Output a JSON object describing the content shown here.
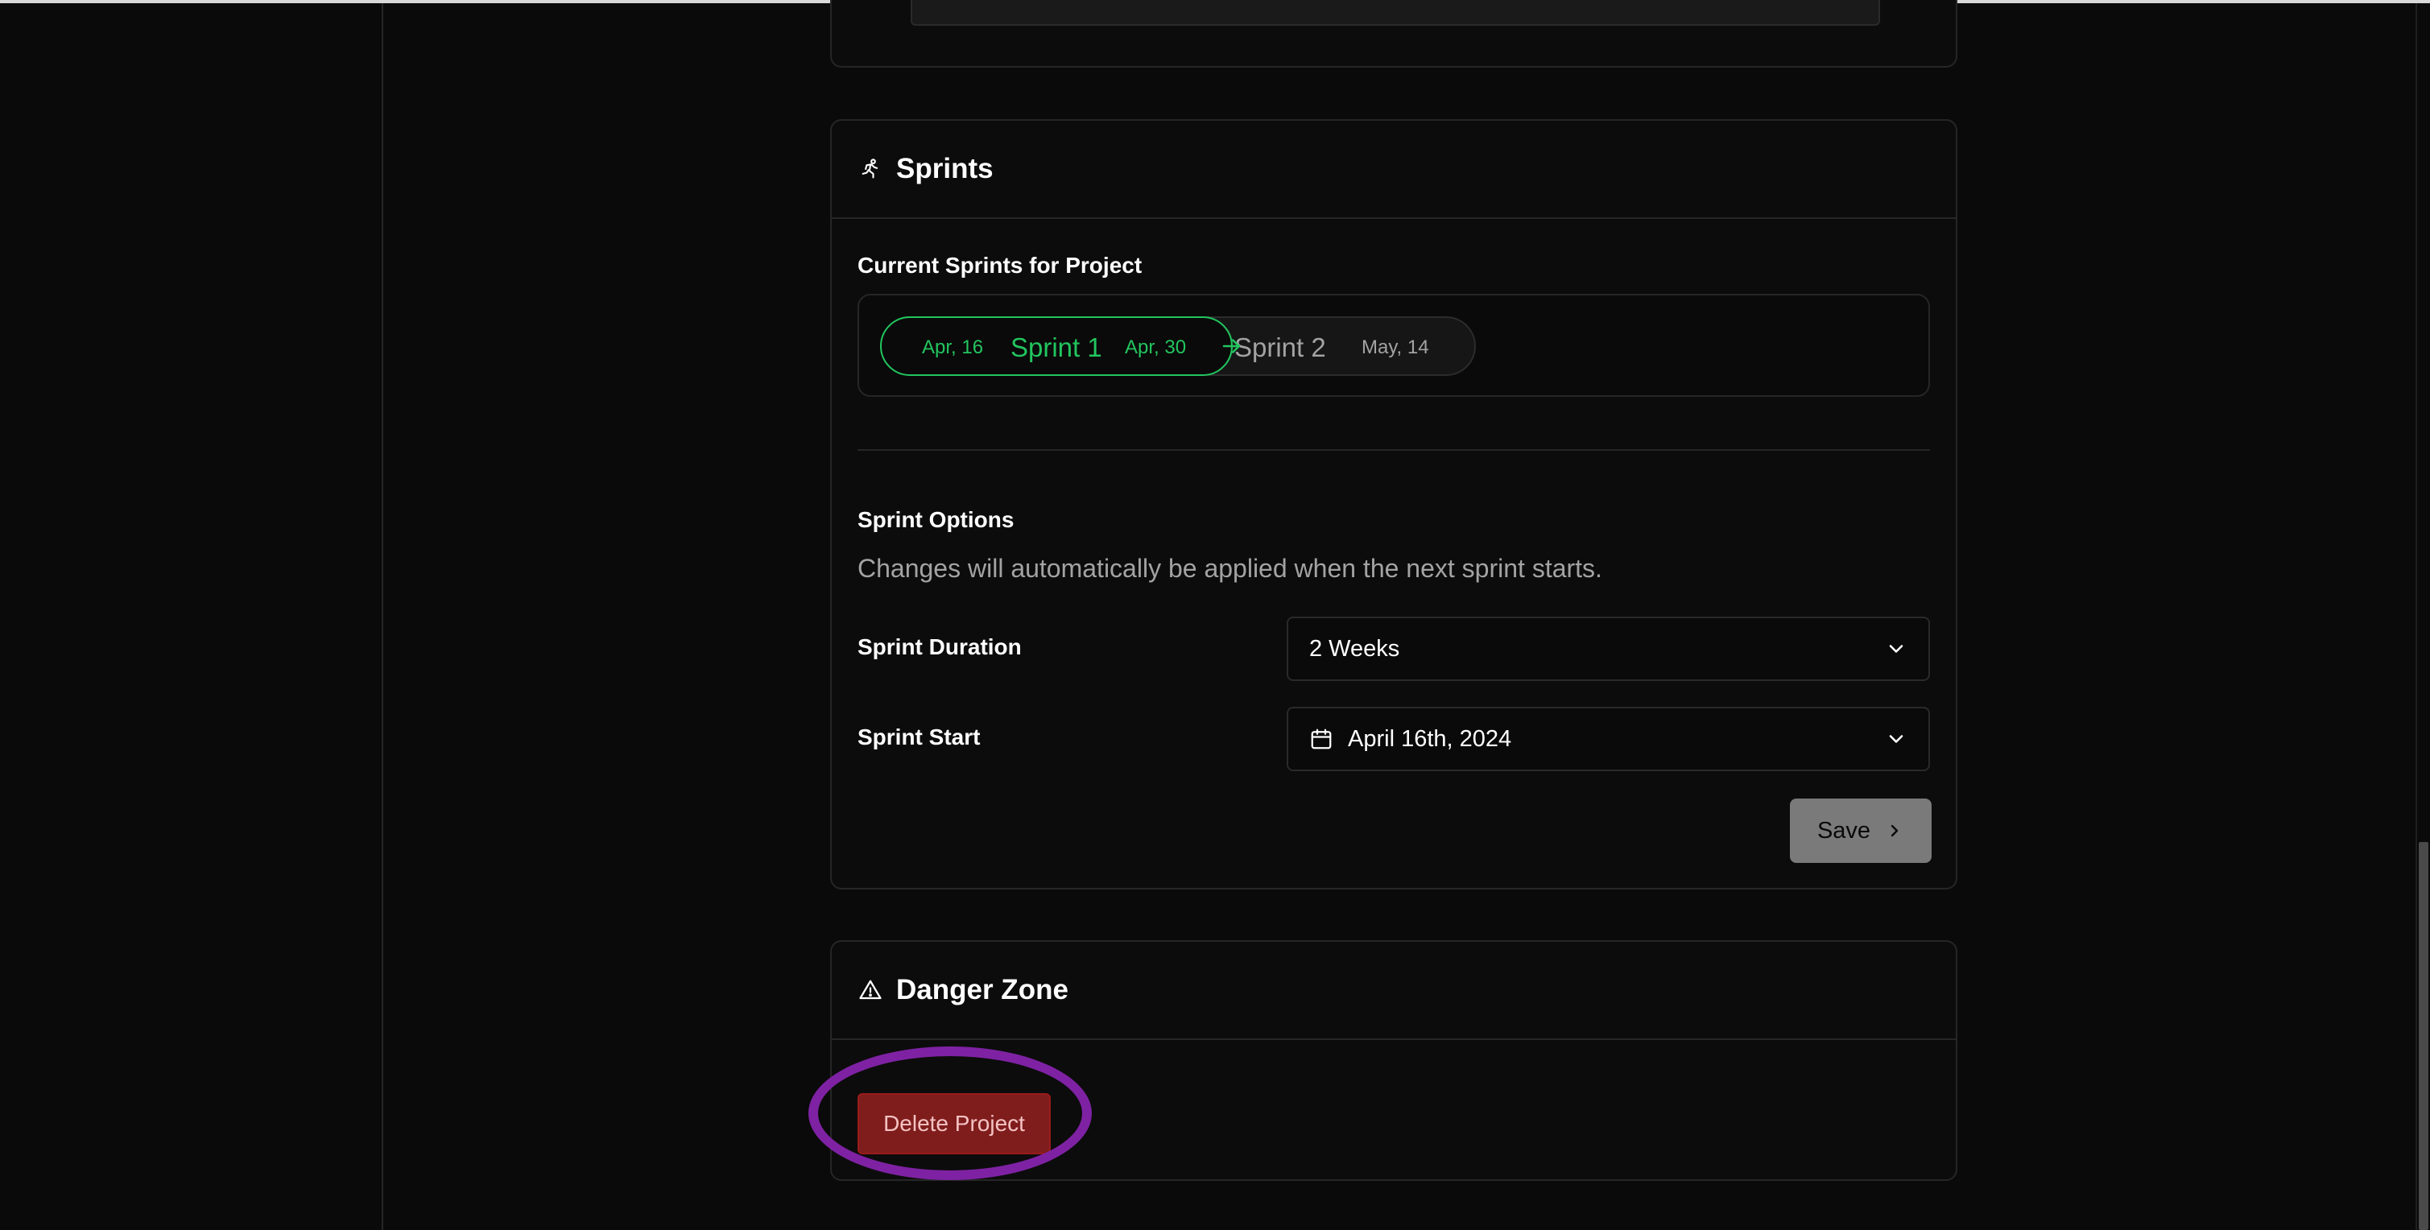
{
  "sprints": {
    "title": "Sprints",
    "current_label": "Current Sprints for Project",
    "active": {
      "start": "Apr, 16",
      "name": "Sprint 1",
      "end": "Apr, 30"
    },
    "next": {
      "name": "Sprint 2",
      "end": "May, 14"
    },
    "options_title": "Sprint Options",
    "options_note": "Changes will automatically be applied when the next sprint starts.",
    "duration_label": "Sprint Duration",
    "duration_value": "2 Weeks",
    "start_label": "Sprint Start",
    "start_value": "April 16th, 2024",
    "save_label": "Save"
  },
  "danger": {
    "title": "Danger Zone",
    "delete_label": "Delete Project"
  },
  "colors": {
    "accent_green": "#22c55e",
    "danger_red": "#7f1d1d",
    "highlight": "#7e22a3"
  }
}
